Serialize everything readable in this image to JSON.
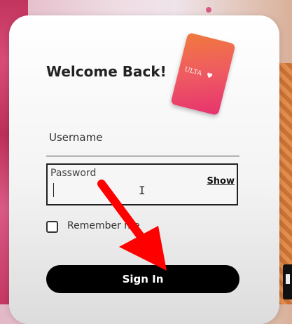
{
  "login": {
    "title": "Welcome Back!",
    "username_label": "Username",
    "password_label": "Password",
    "show_label": "Show",
    "remember_label": "Remember me",
    "signin_label": "Sign In"
  },
  "gift_card": {
    "logo_text": "ULTA",
    "heart": "♥"
  },
  "colors": {
    "accent_arrow": "#ff0000",
    "signin_bg": "#000000"
  },
  "icons": {
    "cursor": "I"
  }
}
